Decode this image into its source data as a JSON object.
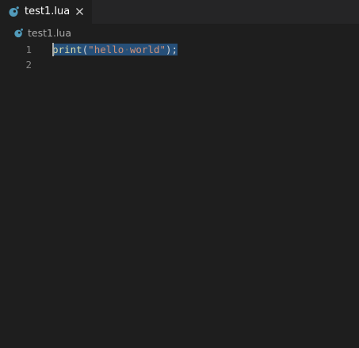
{
  "tab": {
    "label": "test1.lua",
    "icon": "lua-icon",
    "close": "close-icon"
  },
  "breadcrumb": {
    "label": "test1.lua",
    "icon": "lua-icon"
  },
  "code": {
    "lines": [
      {
        "number": "1",
        "tokens": {
          "fn": "print",
          "open": "(",
          "str_open": "\"hello",
          "ws": "·",
          "str_close": "world\"",
          "close": ");"
        }
      },
      {
        "number": "2"
      }
    ]
  },
  "colors": {
    "background": "#1e1e1e",
    "tabbar": "#252526",
    "lua_icon": "#519aba",
    "selection": "#264f78",
    "function": "#dcdcaa",
    "string": "#ce9178",
    "line_number": "#858585"
  }
}
